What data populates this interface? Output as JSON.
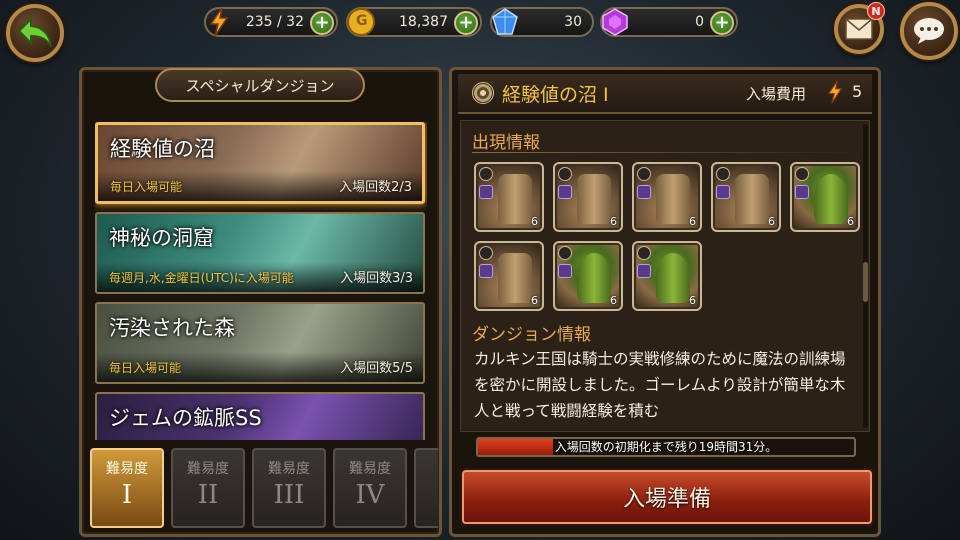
{
  "resources": {
    "stamina": "235 / 32",
    "gold": "18,387",
    "blue_gem": "30",
    "purple_gem": "0",
    "gold_icon_letter": "G"
  },
  "mail_badge": "N",
  "left": {
    "title": "スペシャルダンジョン",
    "dungeons": [
      {
        "name": "経験値の沼",
        "availability": "毎日入場可能",
        "count": "入場回数2/3"
      },
      {
        "name": "神秘の洞窟",
        "availability": "毎週月,水,金曜日(UTC)に入場可能",
        "count": "入場回数3/3"
      },
      {
        "name": "汚染された森",
        "availability": "毎日入場可能",
        "count": "入場回数5/5"
      },
      {
        "name": "ジェムの鉱脈SS",
        "availability": "",
        "count": ""
      }
    ],
    "difficulty_label": "難易度",
    "difficulties": [
      "I",
      "II",
      "III",
      "IV"
    ]
  },
  "right": {
    "title": "経験値の沼 I",
    "entry_cost_label": "入場費用",
    "entry_cost": "5",
    "appear_title": "出現情報",
    "monsters": [
      {
        "type": "wood",
        "level": "6"
      },
      {
        "type": "wood",
        "level": "6"
      },
      {
        "type": "wood",
        "level": "6"
      },
      {
        "type": "wood",
        "level": "6"
      },
      {
        "type": "green",
        "level": "6"
      },
      {
        "type": "wood",
        "level": "6"
      },
      {
        "type": "green",
        "level": "6"
      },
      {
        "type": "green",
        "level": "6"
      }
    ],
    "dungeon_info_title": "ダンジョン情報",
    "description": "カルキン王国は騎士の実戦修練のために魔法の訓練場を密かに開設しました。ゴーレムより設計が簡単な木人と戦って戦闘経験を積む",
    "reset_text": "入場回数の初期化まで残り19時間31分。",
    "reset_progress": 0.2,
    "enter_button": "入場準備"
  },
  "colors": {
    "accent_gold": "#f2c43c",
    "section_orange": "#e8a850",
    "enter_red": "#8a1e0e"
  }
}
